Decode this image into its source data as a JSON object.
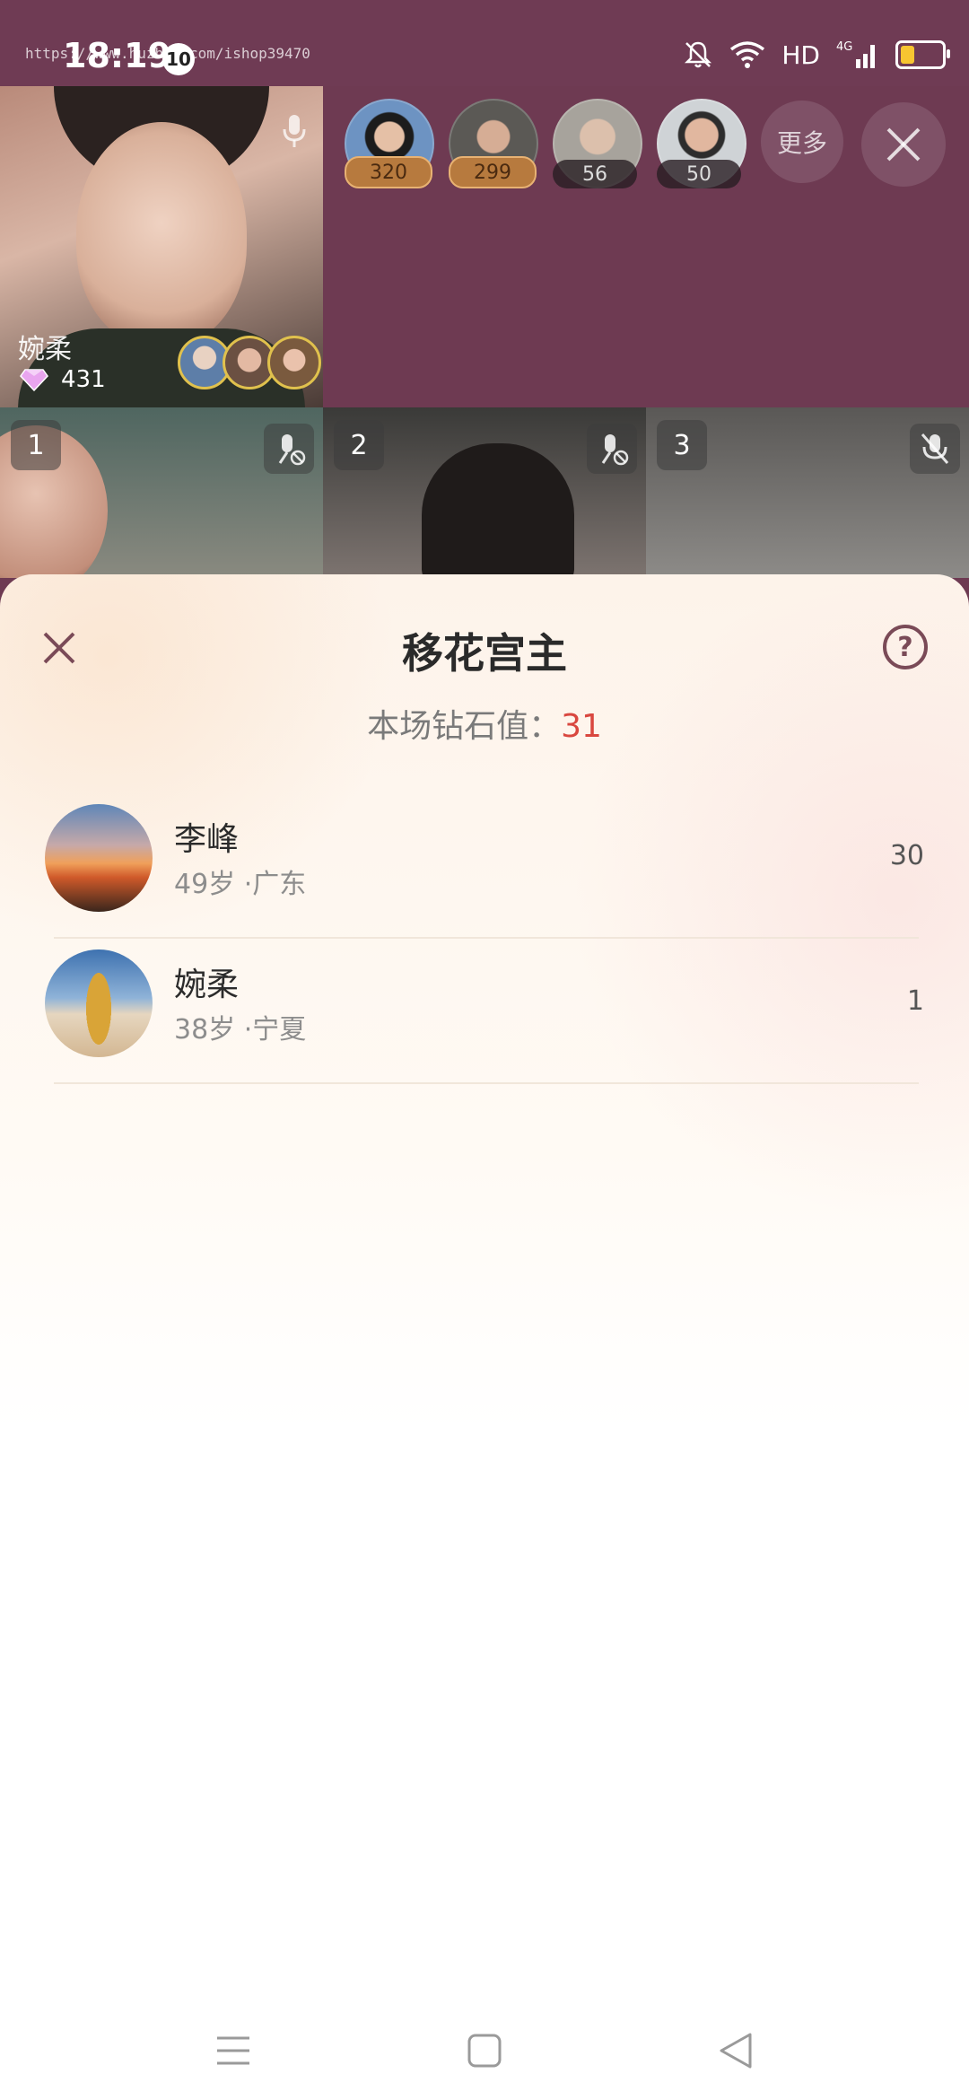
{
  "status_bar": {
    "time": "18:19",
    "notification_count": "10",
    "watermark_url": "https://www.huzhan.com/ishop39470",
    "network_label": "HD",
    "signal_label": "4G",
    "battery_color": "#f7c531",
    "battery_level": 0.35
  },
  "host": {
    "name": "婉柔",
    "diamonds": "431",
    "mic_icon": "microphone-icon",
    "diamond_icon": "diamond-icon"
  },
  "top_ranking": {
    "viewers": [
      {
        "score": "320",
        "badge_style": "gold"
      },
      {
        "score": "299",
        "badge_style": "gold"
      },
      {
        "score": "56",
        "badge_style": "dark"
      },
      {
        "score": "50",
        "badge_style": "dark"
      }
    ],
    "more_label": "更多",
    "close_icon": "close-icon"
  },
  "seats": [
    {
      "number": "1",
      "mic_icon": "mic-off-icon"
    },
    {
      "number": "2",
      "mic_icon": "mic-off-icon"
    },
    {
      "number": "3",
      "mic_icon": "mic-off-icon"
    }
  ],
  "sheet": {
    "title": "移花宫主",
    "subtitle_label": "本场钻石值：",
    "subtitle_value": "31",
    "close_icon": "close-icon",
    "help_icon": "help-icon",
    "help_glyph": "?",
    "accent_color": "#d9473f",
    "list": [
      {
        "name": "李峰",
        "meta": "49岁 ·广东",
        "value": "30"
      },
      {
        "name": "婉柔",
        "meta": "38岁 ·宁夏",
        "value": "1"
      }
    ]
  },
  "nav_bar": {
    "menu_icon": "menu-icon",
    "home_icon": "home-icon",
    "back_icon": "back-icon"
  }
}
